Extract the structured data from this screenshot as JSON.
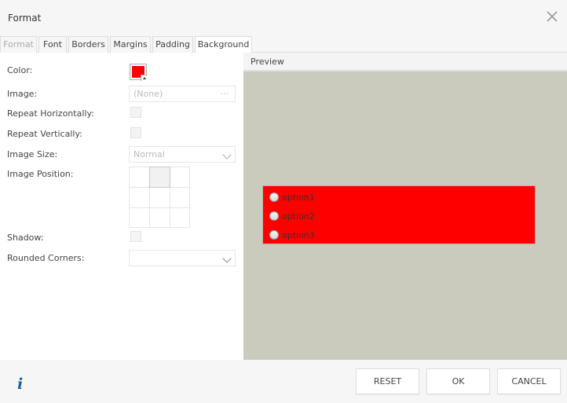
{
  "dialog": {
    "title": "Format"
  },
  "tabs": [
    {
      "label": "Format",
      "state": "disabled"
    },
    {
      "label": "Font",
      "state": "normal"
    },
    {
      "label": "Borders",
      "state": "normal"
    },
    {
      "label": "Margins",
      "state": "normal"
    },
    {
      "label": "Padding",
      "state": "normal"
    },
    {
      "label": "Background",
      "state": "active"
    }
  ],
  "form": {
    "color_label": "Color:",
    "color_value": "#ff0000",
    "image_label": "Image:",
    "image_value": "(None)",
    "image_browse": "···",
    "repeat_h_label": "Repeat Horizontally:",
    "repeat_v_label": "Repeat Vertically:",
    "image_size_label": "Image Size:",
    "image_size_value": "Normal",
    "image_position_label": "Image Position:",
    "image_position_selected": "top-center",
    "shadow_label": "Shadow:",
    "rounded_label": "Rounded Corners:",
    "rounded_value": ""
  },
  "preview": {
    "title": "Preview",
    "background": "#cacabd",
    "box_color": "#ff0000",
    "options": [
      "option1",
      "option2",
      "option3"
    ]
  },
  "footer": {
    "info_icon": "i",
    "reset_label": "RESET",
    "ok_label": "OK",
    "cancel_label": "CANCEL"
  },
  "icons": {
    "close": "close-icon",
    "info": "info-icon",
    "dropdown": "chevron-down-icon"
  }
}
